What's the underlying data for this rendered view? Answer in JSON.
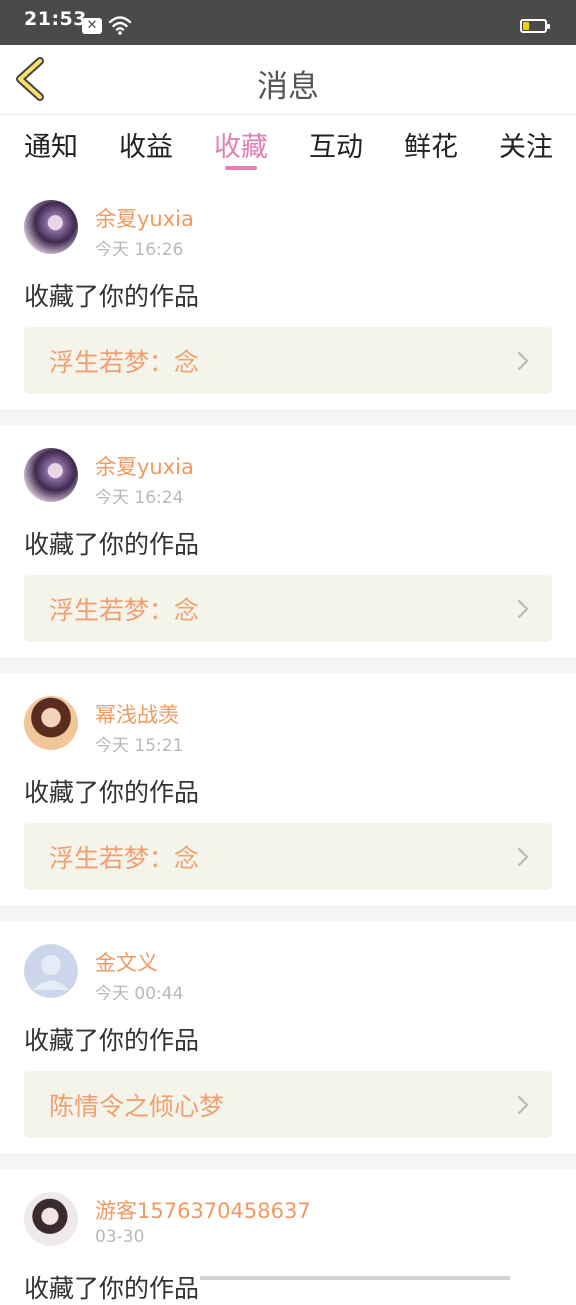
{
  "status_bar": {
    "time": "21:53",
    "notification_icon": "x-box-icon",
    "wifi_icon": "wifi-icon",
    "battery_icon": "battery-low-icon"
  },
  "header": {
    "title": "消息",
    "back_icon": "chevron-left-icon"
  },
  "tabs": [
    {
      "label": "通知",
      "active": false
    },
    {
      "label": "收益",
      "active": false
    },
    {
      "label": "收藏",
      "active": true
    },
    {
      "label": "互动",
      "active": false
    },
    {
      "label": "鲜花",
      "active": false
    },
    {
      "label": "关注",
      "active": false
    }
  ],
  "messages": [
    {
      "username": "余夏yuxia",
      "time": "今天 16:26",
      "action": "收藏了你的作品",
      "work": "浮生若梦：念"
    },
    {
      "username": "余夏yuxia",
      "time": "今天 16:24",
      "action": "收藏了你的作品",
      "work": "浮生若梦：念"
    },
    {
      "username": "幂浅战羡",
      "time": "今天 15:21",
      "action": "收藏了你的作品",
      "work": "浮生若梦：念"
    },
    {
      "username": "金文义",
      "time": "今天 00:44",
      "action": "收藏了你的作品",
      "work": "陈情令之倾心梦"
    },
    {
      "username": "游客1576370458637",
      "time": "03-30",
      "action": "收藏了你的作品"
    }
  ],
  "colors": {
    "accent_pink": "#e57fb3",
    "username_orange": "#ef9a62",
    "work_text": "#f0a070",
    "work_bg": "#f5f4ea"
  }
}
